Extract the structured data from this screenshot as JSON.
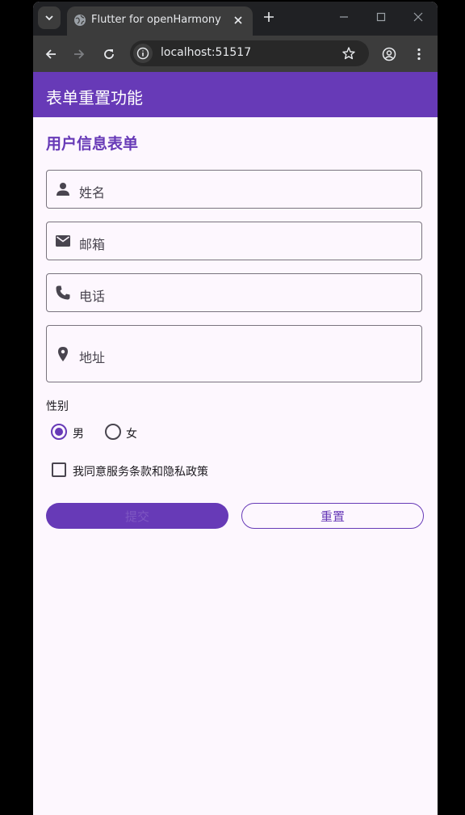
{
  "browser": {
    "tab_title": "Flutter for openHarmony",
    "url": "localhost:51517"
  },
  "app": {
    "title": "表单重置功能",
    "form_heading": "用户信息表单",
    "fields": {
      "name_label": "姓名",
      "email_label": "邮箱",
      "phone_label": "电话",
      "address_label": "地址"
    },
    "gender": {
      "label": "性别",
      "male": "男",
      "female": "女",
      "selected": "男"
    },
    "agreement": {
      "label": "我同意服务条款和隐私政策",
      "checked": false
    },
    "buttons": {
      "submit": "提交",
      "reset": "重置"
    }
  },
  "colors": {
    "primary": "#673ab7",
    "background": "#fdf7fe",
    "browser_dark": "#202124"
  }
}
